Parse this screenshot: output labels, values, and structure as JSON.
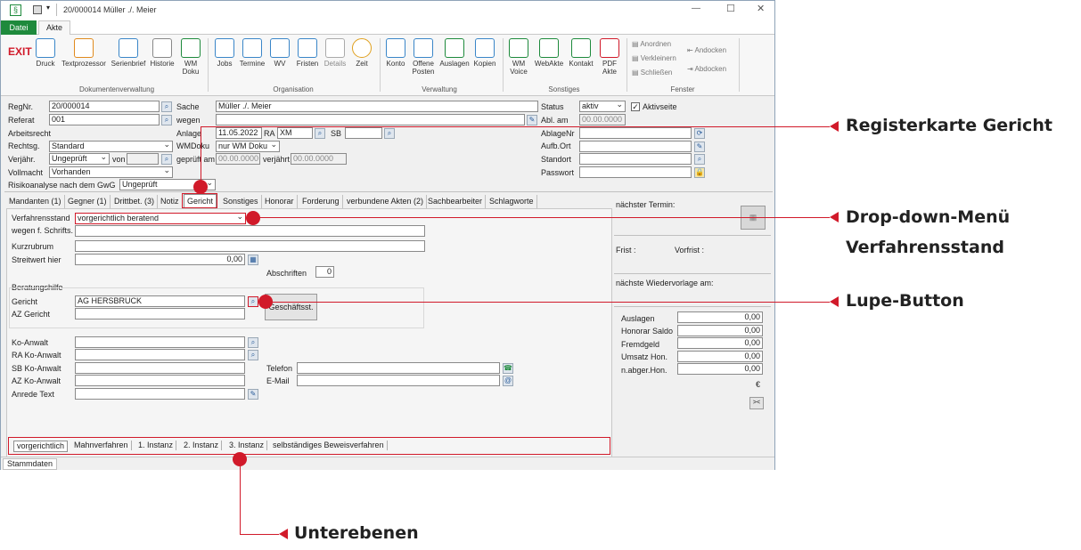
{
  "window": {
    "title": "20/000014 Müller ./. Meier",
    "controls": {
      "minimize": "—",
      "maximize": "☐",
      "close": "✕"
    }
  },
  "menu_tabs": {
    "datei": "Datei",
    "akte": "Akte"
  },
  "ribbon": {
    "exit": "EXIT",
    "buttons": {
      "druck": "Druck",
      "textprozessor": "Textprozessor",
      "serienbrief": "Serienbrief",
      "historie": "Historie",
      "wmdoku": [
        "WM",
        "Doku"
      ],
      "jobs": "Jobs",
      "termine": "Termine",
      "wv": "WV",
      "fristen": "Fristen",
      "details": "Details",
      "zeit": "Zeit",
      "konto": "Konto",
      "offene_posten": [
        "Offene",
        "Posten"
      ],
      "auslagen": "Auslagen",
      "kopien": "Kopien",
      "wmvoice": [
        "WM",
        "Voice"
      ],
      "webakte": "WebAkte",
      "kontakt": "Kontakt",
      "pdfakte": [
        "PDF",
        "Akte"
      ],
      "anordnen": "Anordnen",
      "verkleinern": "Verkleinern",
      "schliessen": "Schließen",
      "andocken": "Andocken",
      "abdocken": "Abdocken"
    },
    "groups": {
      "dokumentenverwaltung": "Dokumentenverwaltung",
      "organisation": "Organisation",
      "verwaltung": "Verwaltung",
      "sonstiges": "Sonstiges",
      "fenster": "Fenster"
    }
  },
  "header": {
    "regnr_label": "RegNr.",
    "regnr": "20/000014",
    "referat_label": "Referat",
    "referat": "001",
    "arbeitsrecht_label": "Arbeitsrecht",
    "rechtsg_label": "Rechtsg.",
    "rechtsg": "Standard",
    "verjaehr_label": "Verjähr.",
    "verjaehr": "Ungeprüft",
    "von_label": "von",
    "vollmacht_label": "Vollmacht",
    "vollmacht": "Vorhanden",
    "risiko_label": "Risikoanalyse nach dem GwG",
    "risiko": "Ungeprüft",
    "sache_label": "Sache",
    "sache": "Müller ./. Meier",
    "wegen_label": "wegen",
    "anlage_label": "Anlage",
    "anlage": "11.05.2022",
    "ra_label": "RA",
    "ra": "XM",
    "sb_label": "SB",
    "wmdoku_label": "WMDoku",
    "wmdoku": "nur WM Doku",
    "geprueft_label": "geprüft am",
    "geprueft": "00.00.0000",
    "verjaehrt_label": "verjährt",
    "verjaehrt": "00.00.0000",
    "status_label": "Status",
    "status": "aktiv",
    "aktivseite_label": "Aktivseite",
    "abl_label": "Abl. am",
    "abl": "00.00.0000",
    "ablagenr_label": "AblageNr",
    "aufb_label": "Aufb.Ort",
    "standort_label": "Standort",
    "passwort_label": "Passwort"
  },
  "subtabs": [
    "Mandanten (1)",
    "Gegner (1)",
    "Drittbet. (3)",
    "Notiz",
    "Gericht",
    "Sonstiges",
    "Honorar",
    "Forderung",
    "verbundene Akten (2)",
    "Sachbearbeiter",
    "Schlagworte"
  ],
  "gericht": {
    "verfahrensstand_label": "Verfahrensstand",
    "verfahrensstand": "vorgerichtlich beratend",
    "wegen_schrifts_label": "wegen f. Schrifts.",
    "kurzrubrum_label": "Kurzrubrum",
    "streitwert_label": "Streitwert hier",
    "streitwert": "0,00",
    "abschriften_label": "Abschriften",
    "abschriften": "0",
    "beratungshilfe_label": "Beratungshilfe",
    "gericht_label": "Gericht",
    "gericht": "AG HERSBRUCK",
    "az_gericht_label": "AZ Gericht",
    "geschaeftsst_button": "Geschäftsst.",
    "ko_anwalt_label": "Ko-Anwalt",
    "ra_ko_anwalt_label": "RA Ko-Anwalt",
    "sb_ko_anwalt_label": "SB Ko-Anwalt",
    "az_ko_anwalt_label": "AZ Ko-Anwalt",
    "anrede_label": "Anrede Text",
    "telefon_label": "Telefon",
    "email_label": "E-Mail"
  },
  "right_panel": {
    "naechster_termin": "nächster Termin:",
    "frist": "Frist :",
    "vorfrist": "Vorfrist :",
    "wiedervorlage": "nächste Wiedervorlage am:",
    "auslagen_label": "Auslagen",
    "auslagen": "0,00",
    "honorar_saldo_label": "Honorar Saldo",
    "honorar_saldo": "0,00",
    "fremdgeld_label": "Fremdgeld",
    "fremdgeld": "0,00",
    "umsatz_label": "Umsatz Hon.",
    "umsatz": "0,00",
    "nabger_label": "n.abger.Hon.",
    "nabger": "0,00",
    "currency": "€",
    "collapse_button": "><"
  },
  "bottom_tabs": [
    "vorgerichtlich",
    "Mahnverfahren",
    "1. Instanz",
    "2. Instanz",
    "3. Instanz",
    "selbständiges Beweisverfahren"
  ],
  "statusbar": {
    "stammdaten": "Stammdaten"
  },
  "callouts": {
    "registerkarte": "Registerkarte Gericht",
    "dropdown_line1": "Drop-down-Menü",
    "dropdown_line2": "Verfahrensstand",
    "lupe": "Lupe-Button",
    "unterebenen": "Unterebenen"
  },
  "colors": {
    "accent": "#1e8a3c",
    "callout_red": "#d11a2a"
  }
}
